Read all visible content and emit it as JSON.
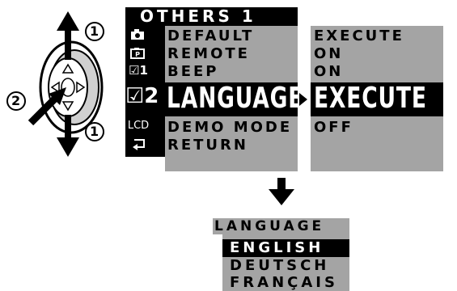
{
  "menu": {
    "title": "OTHERS 1",
    "items": [
      {
        "label": "DEFAULT"
      },
      {
        "label": "REMOTE"
      },
      {
        "label": "BEEP"
      },
      {
        "label": "LANGUAGE"
      },
      {
        "label": "DEMO MODE"
      },
      {
        "label": "RETURN"
      }
    ],
    "values": [
      {
        "label": "EXECUTE"
      },
      {
        "label": "ON"
      },
      {
        "label": "ON"
      },
      {
        "label": "EXECUTE"
      },
      {
        "label": "OFF"
      }
    ],
    "sidebar": {
      "tab1": "☑1",
      "tab2": "☑2",
      "lcd": "LCD"
    }
  },
  "dial": {
    "label_up": "1",
    "label_press": "2",
    "label_down": "1"
  },
  "language_menu": {
    "title": "LANGUAGE",
    "options": [
      {
        "label": "ENGLISH"
      },
      {
        "label": "DEUTSCH"
      },
      {
        "label": "FRANÇAIS"
      }
    ]
  },
  "colors": {
    "menu_bg": "#a4a4a4",
    "highlight": "#000000"
  }
}
